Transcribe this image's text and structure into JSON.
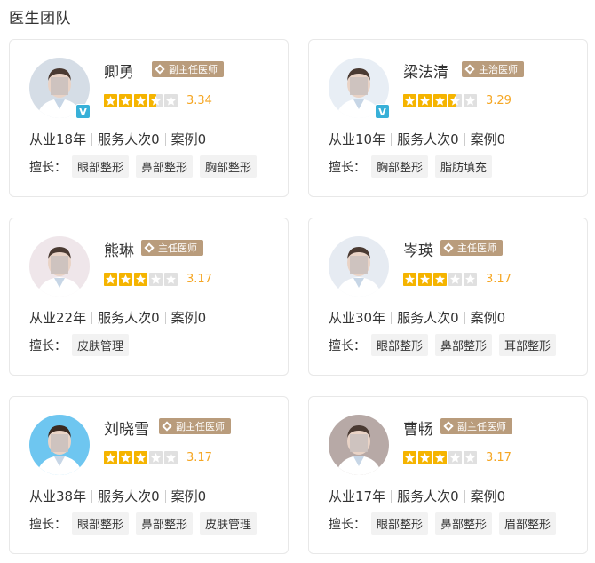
{
  "section_title": "医生团队",
  "colors": {
    "star": "#f5b400",
    "rating_text": "#f5a623",
    "badge": "#b99c7c",
    "verified": "#38b0d8"
  },
  "doctors": [
    {
      "name": "卿勇",
      "title": "副主任医师",
      "rating": 3.34,
      "rating_text": "3.34",
      "stars": 3.5,
      "verified": true,
      "years": "从业18年",
      "served": "服务人次0",
      "cases": "案例0",
      "skills_label": "擅长：",
      "skills": [
        "眼部整形",
        "鼻部整形",
        "胸部整形"
      ]
    },
    {
      "name": "梁法清",
      "title": "主治医师",
      "rating": 3.29,
      "rating_text": "3.29",
      "stars": 3.5,
      "verified": true,
      "years": "从业10年",
      "served": "服务人次0",
      "cases": "案例0",
      "skills_label": "擅长：",
      "skills": [
        "胸部整形",
        "脂肪填充"
      ]
    },
    {
      "name": "熊琳",
      "title": "主任医师",
      "rating": 3.17,
      "rating_text": "3.17",
      "stars": 3,
      "verified": false,
      "years": "从业22年",
      "served": "服务人次0",
      "cases": "案例0",
      "skills_label": "擅长：",
      "skills": [
        "皮肤管理"
      ]
    },
    {
      "name": "岑瑛",
      "title": "主任医师",
      "rating": 3.17,
      "rating_text": "3.17",
      "stars": 3,
      "verified": false,
      "years": "从业30年",
      "served": "服务人次0",
      "cases": "案例0",
      "skills_label": "擅长：",
      "skills": [
        "眼部整形",
        "鼻部整形",
        "耳部整形"
      ]
    },
    {
      "name": "刘晓雪",
      "title": "副主任医师",
      "rating": 3.17,
      "rating_text": "3.17",
      "stars": 3,
      "verified": false,
      "years": "从业38年",
      "served": "服务人次0",
      "cases": "案例0",
      "skills_label": "擅长：",
      "skills": [
        "眼部整形",
        "鼻部整形",
        "皮肤管理"
      ]
    },
    {
      "name": "曹畅",
      "title": "副主任医师",
      "rating": 3.17,
      "rating_text": "3.17",
      "stars": 3,
      "verified": false,
      "years": "从业17年",
      "served": "服务人次0",
      "cases": "案例0",
      "skills_label": "擅长：",
      "skills": [
        "眼部整形",
        "鼻部整形",
        "眉部整形"
      ]
    }
  ]
}
